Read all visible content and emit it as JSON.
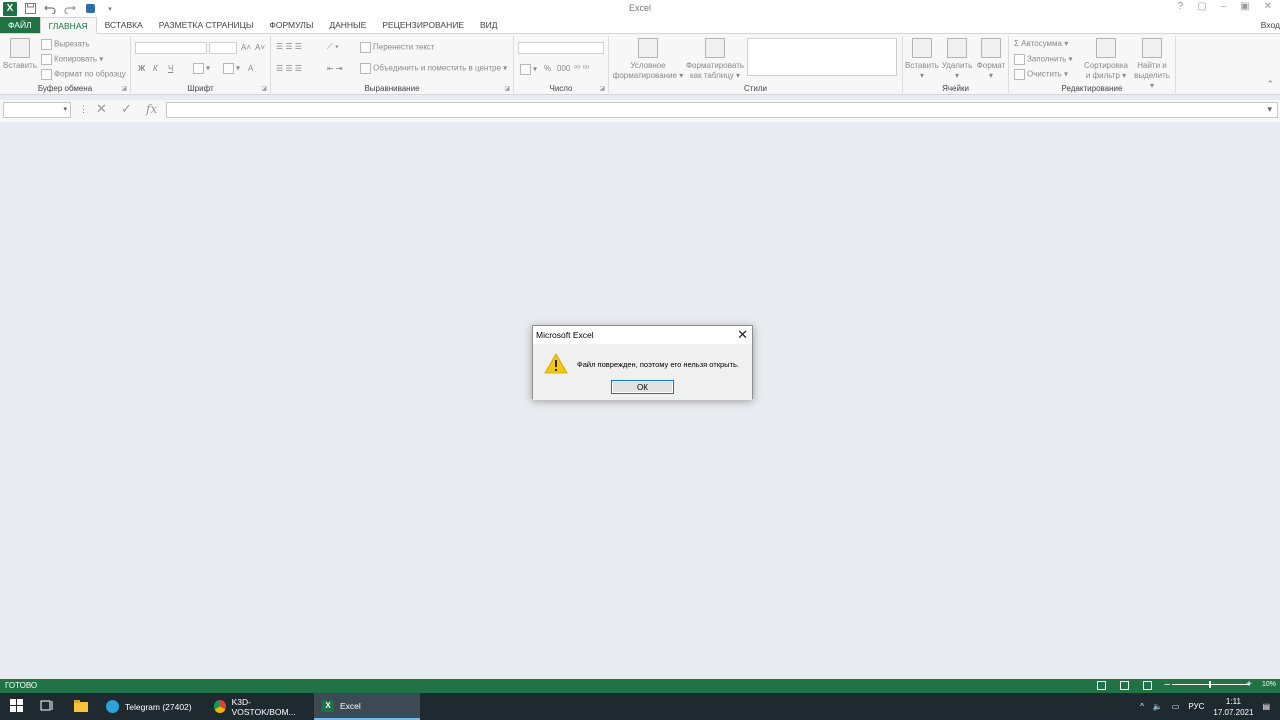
{
  "window": {
    "title": "Excel",
    "signin": "Вход",
    "controls": [
      "?",
      "▢",
      "–",
      "▣",
      "✕"
    ]
  },
  "qat": {
    "icons": [
      "excel-logo",
      "save-icon",
      "undo-icon",
      "redo-icon",
      "touch-mode-icon",
      "customize-icon"
    ]
  },
  "tabs": [
    {
      "label": "ФАЙЛ"
    },
    {
      "label": "ГЛАВНАЯ"
    },
    {
      "label": "ВСТАВКА"
    },
    {
      "label": "РАЗМЕТКА СТРАНИЦЫ"
    },
    {
      "label": "ФОРМУЛЫ"
    },
    {
      "label": "ДАННЫЕ"
    },
    {
      "label": "РЕЦЕНЗИРОВАНИЕ"
    },
    {
      "label": "ВИД"
    }
  ],
  "ribbon": {
    "clipboard": {
      "label": "Буфер обмена",
      "paste": "Вставить",
      "cut": "Вырезать",
      "copy": "Копировать",
      "format_painter": "Формат по образцу"
    },
    "font": {
      "label": "Шрифт",
      "bold": "Ж",
      "italic": "К",
      "underline": "Ч",
      "grow": "A˄",
      "shrink": "A˅",
      "color": "A"
    },
    "alignment": {
      "label": "Выравнивание",
      "wrap": "Перенести текст",
      "merge": "Объединить и поместить в центре"
    },
    "number": {
      "label": "Число",
      "percent": "%",
      "thousands": "000"
    },
    "styles": {
      "label": "Стили",
      "conditional": "Условное форматирование",
      "as_table": "Форматировать как таблицу"
    },
    "cells": {
      "label": "Ячейки",
      "insert": "Вставить",
      "delete": "Удалить",
      "format": "Формат"
    },
    "editing": {
      "label": "Редактирование",
      "autosum": "Автосумма",
      "fill": "Заполнить",
      "clear": "Очистить",
      "sort": "Сортировка и фильтр",
      "find": "Найти и выделить"
    }
  },
  "formula_bar": {
    "name_box": "",
    "formula": "",
    "fx": "fx"
  },
  "dialog": {
    "title": "Microsoft Excel",
    "message": "Файл поврежден, поэтому его нельзя открыть.",
    "ok": "ОК"
  },
  "status": {
    "text": "ГОТОВО",
    "zoom": "10%"
  },
  "taskbar": {
    "items": [
      {
        "label": "Telegram (27402)"
      },
      {
        "label": "K3D-VOSTOK/BOM..."
      },
      {
        "label": "Excel"
      }
    ],
    "lang": "РУС",
    "time": "1:11",
    "date": "17.07.2021"
  },
  "colors": {
    "excel_green": "#217346",
    "taskbar": "#1f2a30",
    "workspace": "#e8ebef"
  }
}
